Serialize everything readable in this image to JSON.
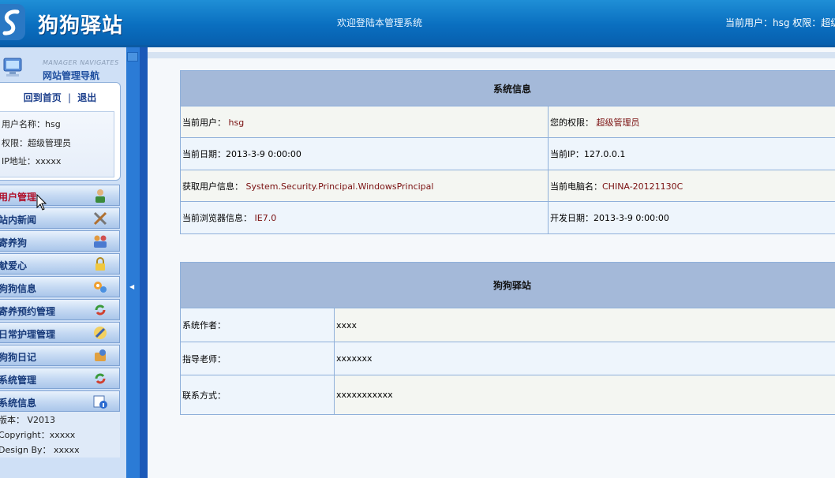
{
  "header": {
    "title": "狗狗驿站",
    "welcome": "欢迎登陆本管理系统",
    "user_info": "当前用户：hsg 权限：超级"
  },
  "sidebar": {
    "nav_subtitle": "MANAGER NAVIGATES",
    "nav_title": "网站管理导航",
    "home_link": "回到首页",
    "separator": "|",
    "logout_link": "退出",
    "username_line": "用户名称：hsg",
    "role_line": "权限：超级管理员",
    "ip_line": "IP地址：xxxxx",
    "menu": [
      {
        "label": "用户管理",
        "icon": "user-icon"
      },
      {
        "label": "站内新闻",
        "icon": "tools-icon"
      },
      {
        "label": "寄养狗",
        "icon": "group-icon"
      },
      {
        "label": "献爱心",
        "icon": "lock-icon"
      },
      {
        "label": "狗狗信息",
        "icon": "gears-icon"
      },
      {
        "label": "寄养预约管理",
        "icon": "refresh-icon"
      },
      {
        "label": "日常护理管理",
        "icon": "edit-icon"
      },
      {
        "label": "狗狗日记",
        "icon": "box-icon"
      },
      {
        "label": "系统管理",
        "icon": "refresh-icon"
      },
      {
        "label": "系统信息",
        "icon": "info-icon"
      }
    ],
    "footer": {
      "version": "版本： V2013",
      "copyright": "Copyright：xxxxx",
      "design": "Design By： xxxxx"
    }
  },
  "system_info": {
    "title": "系统信息",
    "current_user_label": "当前用户：",
    "current_user_value": "hsg",
    "role_label": "您的权限：",
    "role_value": "超级管理员",
    "date_label": "当前日期：",
    "date_value": "2013-3-9 0:00:00",
    "ip_label": "当前IP：",
    "ip_value": "127.0.0.1",
    "identity_label": "获取用户信息：",
    "identity_value": "System.Security.Principal.WindowsPrincipal",
    "computer_label": "当前电脑名：",
    "computer_value": "CHINA-20121130C",
    "browser_label": "当前浏览器信息：",
    "browser_value": "IE7.0",
    "dev_date_label": "开发日期：",
    "dev_date_value": "2013-3-9 0:00:00"
  },
  "site_info": {
    "title": "狗狗驿站",
    "rows": [
      {
        "label": "系统作者：",
        "value": "xxxx"
      },
      {
        "label": "指导老师：",
        "value": "xxxxxxx"
      },
      {
        "label": "联系方式：",
        "value": "xxxxxxxxxxx"
      }
    ]
  },
  "colors": {
    "header_blue": "#0a6fc0",
    "sidebar_bg": "#cfe0f6",
    "table_header": "#a4b9d9",
    "value_text": "#7a1010",
    "active_menu": "#b0102a"
  }
}
